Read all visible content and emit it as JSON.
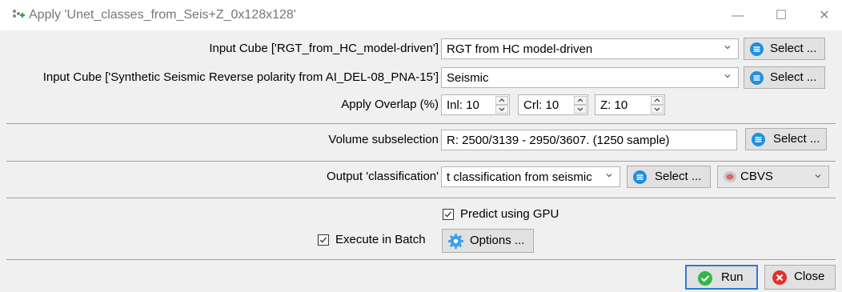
{
  "window": {
    "title": "Apply 'Unet_classes_from_Seis+Z_0x128x128'",
    "minimize_glyph": "—",
    "maximize_glyph": "☐",
    "close_glyph": "✕"
  },
  "input_cube_1": {
    "label": "Input Cube ['RGT_from_HC_model-driven']",
    "value": "RGT  from  HC  model-driven",
    "select_label": "Select ..."
  },
  "input_cube_2": {
    "label": "Input Cube ['Synthetic Seismic Reverse polarity from AI_DEL-08_PNA-15']",
    "value": "Seismic",
    "select_label": "Select ..."
  },
  "overlap": {
    "label": "Apply Overlap (%)",
    "inl": "Inl: 10",
    "crl": "Crl: 10",
    "z": "Z: 10"
  },
  "volume": {
    "label": "Volume subselection",
    "value": "R: 2500/3139 - 2950/3607.  (1250 sample)",
    "select_label": "Select ..."
  },
  "output": {
    "label": "Output 'classification'",
    "value": "t classification from seismic",
    "select_label": "Select ...",
    "format_value": "CBVS"
  },
  "options": {
    "predict_gpu_label": "Predict using GPU",
    "batch_label": "Execute in Batch",
    "options_button": "Options ..."
  },
  "footer": {
    "run_label": "Run",
    "close_label": "Close"
  },
  "colors": {
    "accent": "#1e90e0",
    "run_green": "#2fb84a",
    "close_red": "#e0322d"
  }
}
